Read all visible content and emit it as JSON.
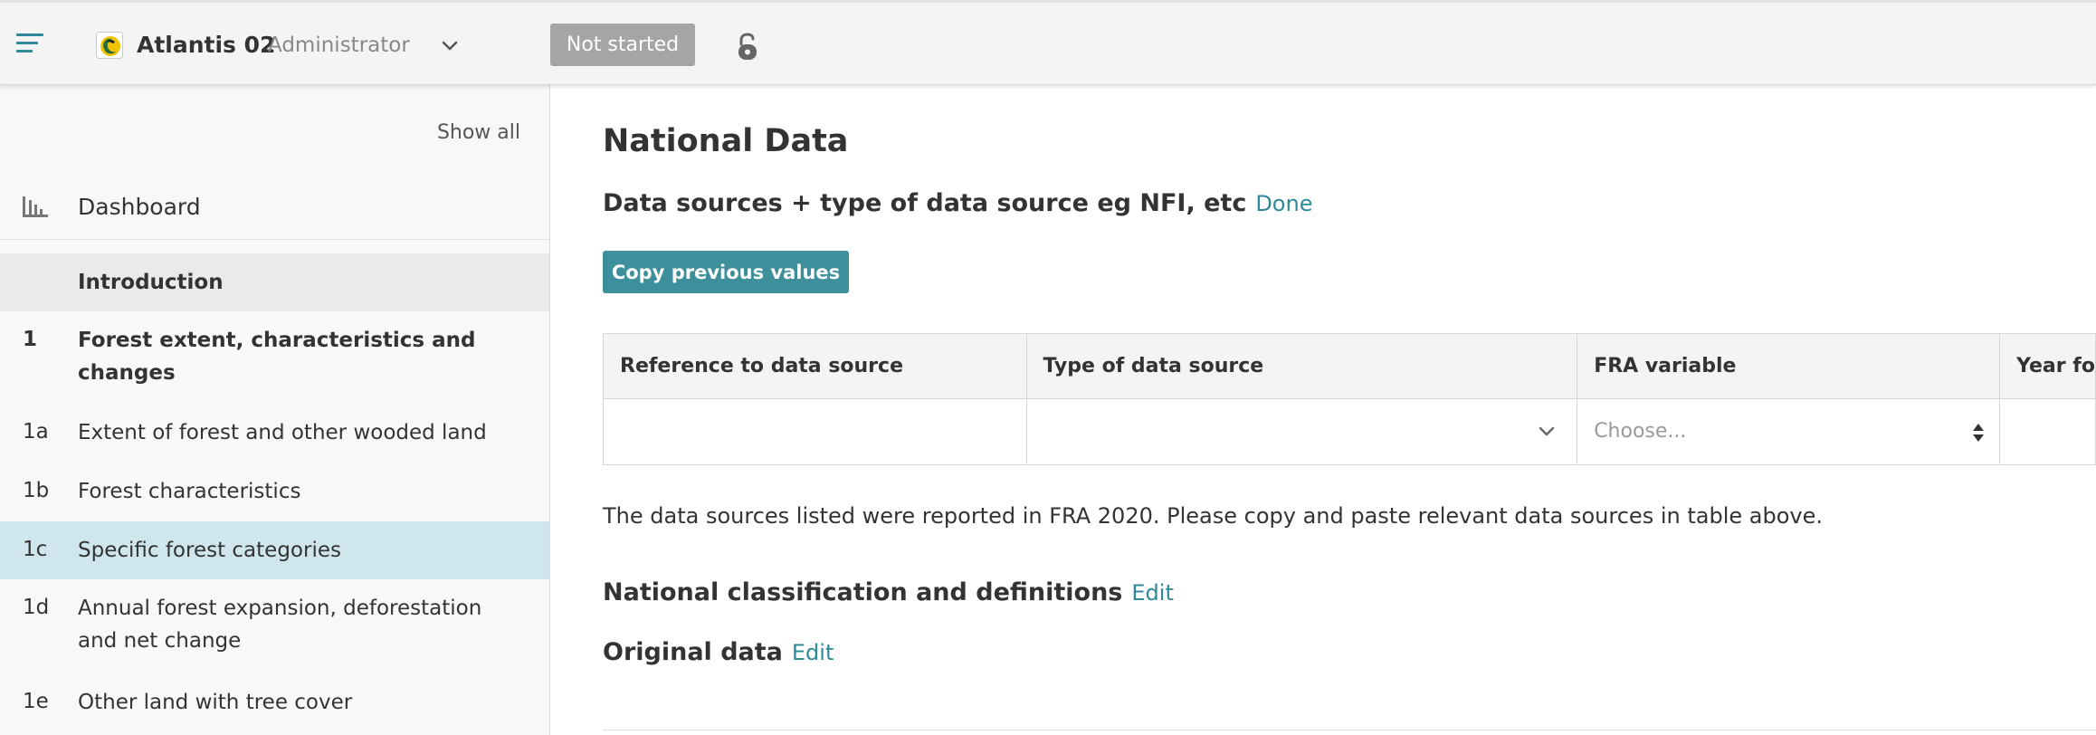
{
  "header": {
    "country_name": "Atlantis 02",
    "role": "Administrator",
    "status": "Not started",
    "accent_color": "#2e8a9a",
    "status_color": "#a5a5a5"
  },
  "sidebar": {
    "show_all": "Show all",
    "dashboard": "Dashboard",
    "items": [
      {
        "number": "",
        "label": "Introduction"
      },
      {
        "number": "1",
        "label": "Forest extent, characteristics and changes"
      },
      {
        "number": "1a",
        "label": "Extent of forest and other wooded land"
      },
      {
        "number": "1b",
        "label": "Forest characteristics"
      },
      {
        "number": "1c",
        "label": "Specific forest categories"
      },
      {
        "number": "1d",
        "label": "Annual forest expansion, deforestation and net change"
      },
      {
        "number": "1e",
        "label": "Other land with tree cover"
      }
    ],
    "active_item": "1c",
    "active_color": "#cfe6ec"
  },
  "main": {
    "title": "National Data",
    "data_sources": {
      "heading": "Data sources + type of data source eg NFI, etc",
      "link": "Done"
    },
    "copy_button": "Copy previous values",
    "table": {
      "columns": [
        "Reference to data source",
        "Type of data source",
        "FRA variable",
        "Year fo"
      ],
      "row": {
        "reference": "",
        "type": "",
        "fra_variable_placeholder": "Choose...",
        "year": ""
      }
    },
    "note": "The data sources listed were reported in FRA 2020. Please copy and paste relevant data sources in table above.",
    "national_classification": {
      "heading": "National classification and definitions",
      "link": "Edit"
    },
    "original_data": {
      "heading": "Original data",
      "link": "Edit"
    }
  }
}
